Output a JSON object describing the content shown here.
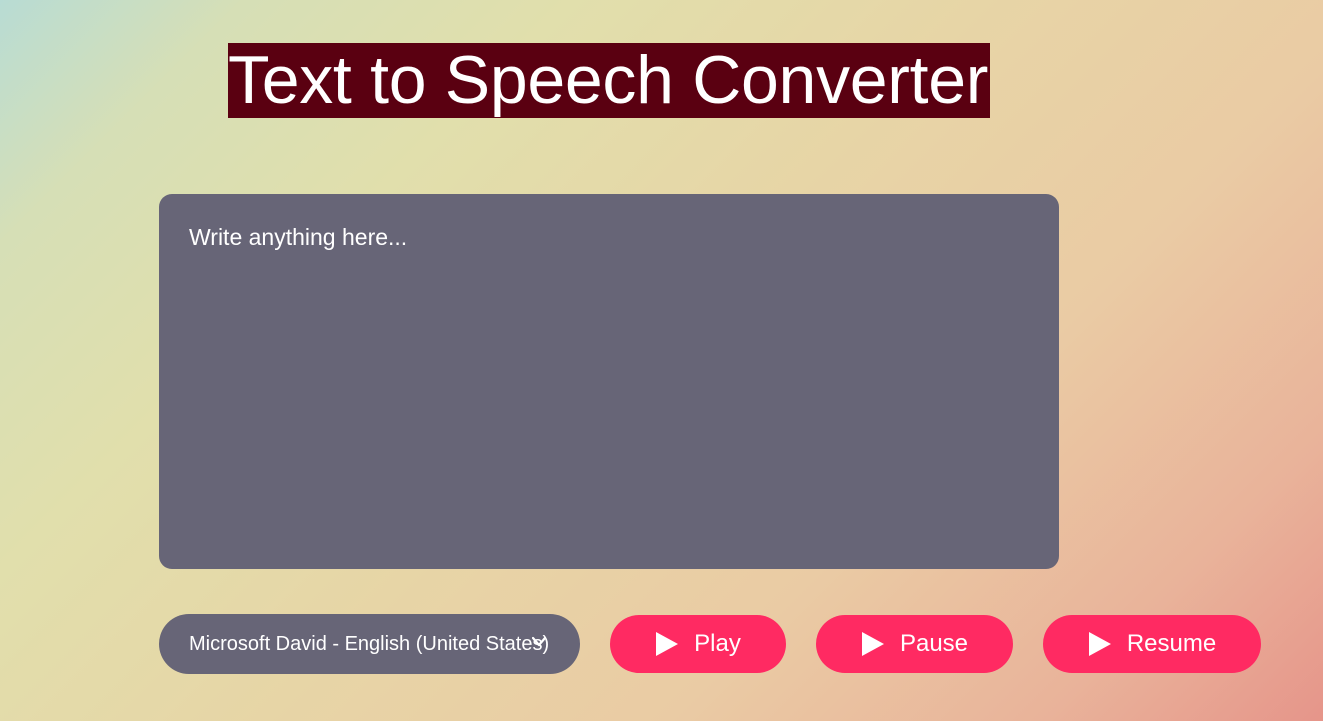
{
  "header": {
    "title": "Text to Speech Converter"
  },
  "editor": {
    "placeholder": "Write anything here...",
    "value": ""
  },
  "voice_select": {
    "selected": "Microsoft David - English (United States)",
    "icon": "chevron-down-icon"
  },
  "controls": {
    "play_label": "Play",
    "pause_label": "Pause",
    "resume_label": "Resume",
    "icon": "play-icon"
  },
  "colors": {
    "title_bg": "#5a0011",
    "panel_bg": "#676577",
    "button_bg": "#ff2a62",
    "text": "#ffffff"
  }
}
